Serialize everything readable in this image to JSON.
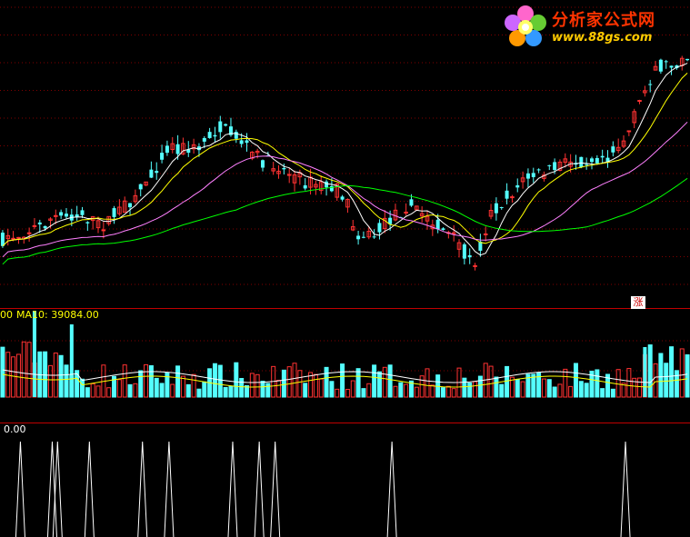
{
  "logo": {
    "title": "分析家公式网",
    "url": "www.88gs.com"
  },
  "volume_panel": {
    "label_prefix": "00",
    "ma_label": "MA10: 39084.00"
  },
  "indicator_panel": {
    "label": "0.00"
  },
  "badge": {
    "text": "涨"
  },
  "colors": {
    "background": "#000000",
    "up_candle": "#ff3232",
    "down_candle": "#54ffff",
    "ma5": "#ffffff",
    "ma10": "#ffff00",
    "ma20": "#ff80ff",
    "ma60": "#00ff00",
    "panel_divider": "#c00000",
    "grid": "#800000",
    "indicator_line": "#ffffff"
  },
  "chart_data": {
    "type": "candlestick",
    "price_bars": 130,
    "spike_bars": [
      3,
      9,
      10,
      16,
      26,
      31,
      43,
      48,
      51,
      73,
      117
    ],
    "series": [
      {
        "name": "MA10",
        "values": []
      }
    ]
  }
}
